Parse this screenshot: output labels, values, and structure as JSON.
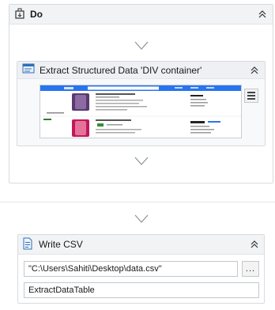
{
  "sequence": {
    "title": "Do",
    "icon": "sequence-icon"
  },
  "extract_activity": {
    "title": "Extract Structured Data 'DIV  container'",
    "icon": "extract-data-icon",
    "menu_icon": "hamburger-menu-icon"
  },
  "write_csv": {
    "title": "Write CSV",
    "icon": "write-csv-icon",
    "file_path": "\"C:\\Users\\Sahiti\\Desktop\\data.csv\"",
    "browse_label": "...",
    "data_table": "ExtractDataTable"
  },
  "colors": {
    "header_bg": "#f1f3f5",
    "border": "#d7dbe0",
    "arrow": "#8c939b",
    "accent_blue": "#2874f0"
  }
}
